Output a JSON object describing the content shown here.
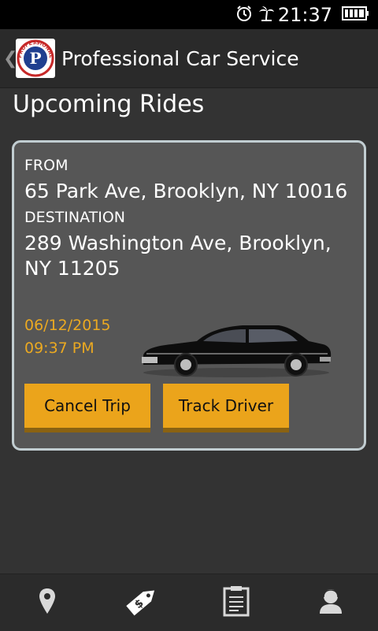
{
  "status_bar": {
    "time": "21:37",
    "icons": [
      "alarm-icon",
      "palm-tree-icon",
      "battery-icon"
    ]
  },
  "action_bar": {
    "back_icon": "chevron-left-icon",
    "logo_text": "PROFESSIONAL",
    "logo_letter": "P",
    "title": "Professional Car Service"
  },
  "page": {
    "title": "Upcoming Rides"
  },
  "ride": {
    "from_label": "FROM",
    "from_address": "65 Park Ave, Brooklyn, NY 10016",
    "destination_label": "DESTINATION",
    "destination_address": "289 Washington Ave, Brooklyn, NY 11205",
    "date": "06/12/2015",
    "time": "09:37 PM",
    "cancel_label": "Cancel Trip",
    "track_label": "Track Driver"
  },
  "colors": {
    "accent": "#eba41b",
    "date_text": "#eba921",
    "card_border": "#c1cdd1",
    "card_bg": "#565656",
    "background": "#333333"
  },
  "bottom_nav": {
    "items": [
      "map-pin-icon",
      "price-tag-icon",
      "clipboard-icon",
      "user-icon"
    ],
    "selected": "price-tag-icon"
  }
}
